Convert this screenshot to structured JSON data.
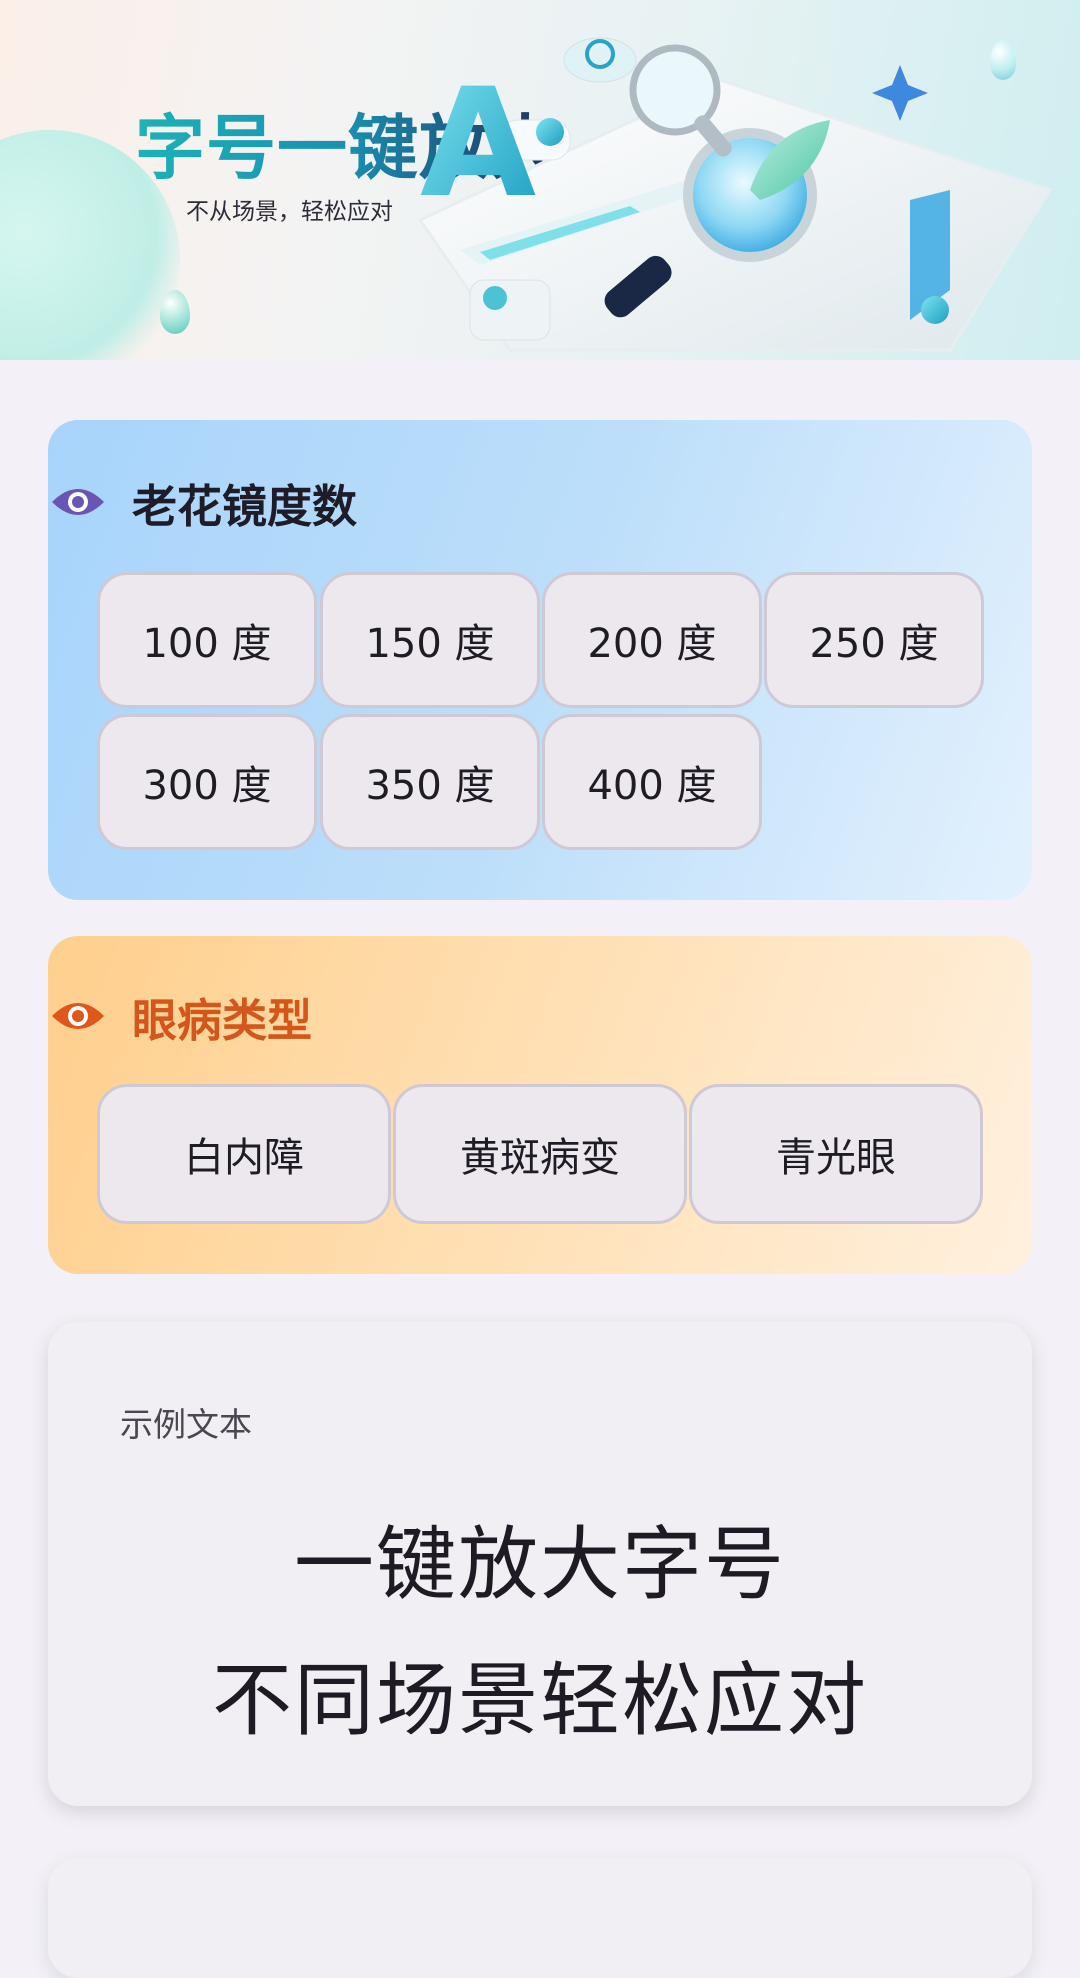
{
  "banner": {
    "title": "字号一键放大",
    "subtitle": "不从场景，轻松应对",
    "illustration_letter": "A"
  },
  "lens_section": {
    "icon": "eye-icon",
    "title": "老花镜度数",
    "title_color": "#1f1c29",
    "icon_color": "#6a55b5",
    "options": [
      "100 度",
      "150 度",
      "200 度",
      "250 度",
      "300 度",
      "350 度",
      "400 度"
    ]
  },
  "disease_section": {
    "icon": "eye-icon",
    "title": "眼病类型",
    "title_color": "#d4561a",
    "icon_color": "#e0571a",
    "options": [
      "白内障",
      "黄斑病变",
      "青光眼"
    ]
  },
  "sample_section": {
    "label": "示例文本",
    "lines": [
      "一键放大字号",
      "不同场景轻松应对"
    ]
  }
}
